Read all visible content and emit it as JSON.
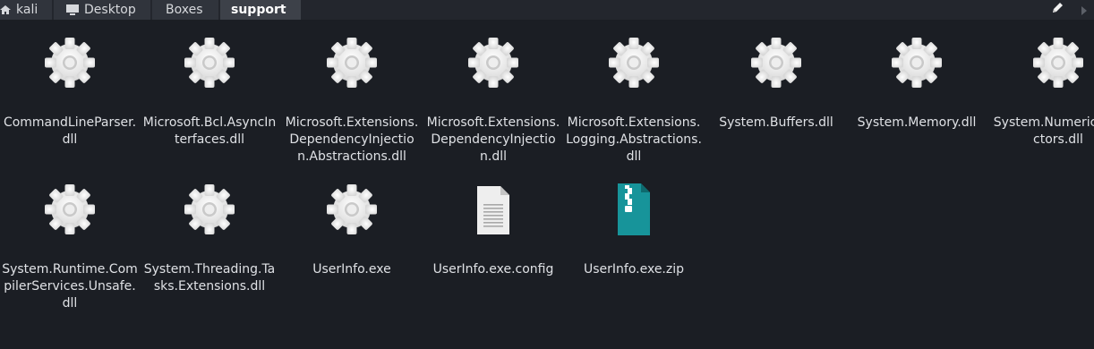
{
  "path_bar": {
    "crumbs": [
      {
        "label": "kali",
        "icon": "home-icon"
      },
      {
        "label": "Desktop",
        "icon": "desktop-icon"
      },
      {
        "label": "Boxes",
        "icon": ""
      },
      {
        "label": "support",
        "icon": ""
      }
    ],
    "edit_icon": "pencil-icon",
    "next_icon": "chevron-right-icon"
  },
  "files": [
    {
      "name": "CommandLineParser.dll",
      "type": "library",
      "icon": "gear-icon"
    },
    {
      "name": "Microsoft.Bcl.AsyncInterfaces.dll",
      "type": "library",
      "icon": "gear-icon"
    },
    {
      "name": "Microsoft.Extensions.DependencyInjection.Abstractions.dll",
      "type": "library",
      "icon": "gear-icon"
    },
    {
      "name": "Microsoft.Extensions.DependencyInjection.dll",
      "type": "library",
      "icon": "gear-icon"
    },
    {
      "name": "Microsoft.Extensions.Logging.Abstractions.dll",
      "type": "library",
      "icon": "gear-icon"
    },
    {
      "name": "System.Buffers.dll",
      "type": "library",
      "icon": "gear-icon"
    },
    {
      "name": "System.Memory.dll",
      "type": "library",
      "icon": "gear-icon"
    },
    {
      "name": "System.Numerics.Vectors.dll",
      "type": "library",
      "icon": "gear-icon"
    },
    {
      "name": "System.Runtime.CompilerServices.Unsafe.dll",
      "type": "library",
      "icon": "gear-icon"
    },
    {
      "name": "System.Threading.Tasks.Extensions.dll",
      "type": "library",
      "icon": "gear-icon"
    },
    {
      "name": "UserInfo.exe",
      "type": "executable",
      "icon": "gear-icon"
    },
    {
      "name": "UserInfo.exe.config",
      "type": "text",
      "icon": "text-document-icon"
    },
    {
      "name": "UserInfo.exe.zip",
      "type": "archive",
      "icon": "zip-archive-icon"
    }
  ],
  "colors": {
    "background": "#1b1e24",
    "pathbar": "#23262d",
    "crumb": "#30343c",
    "crumb_active": "#3d4149",
    "label_text": "#dfe1e5",
    "archive_teal": "#17949a"
  }
}
